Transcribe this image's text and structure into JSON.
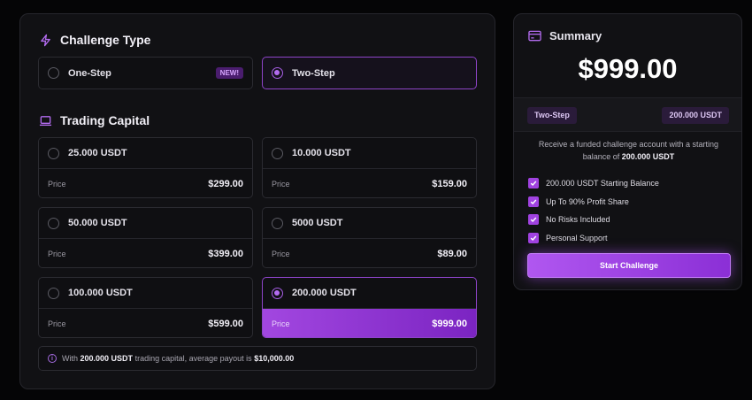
{
  "accent": "#a247e0",
  "challenge_type": {
    "title": "Challenge Type",
    "icon": "lightning-icon",
    "options": [
      {
        "label": "One-Step",
        "badge": "NEW!",
        "selected": false
      },
      {
        "label": "Two-Step",
        "selected": true
      }
    ]
  },
  "trading_capital": {
    "title": "Trading Capital",
    "icon": "laptop-icon",
    "price_label": "Price",
    "options": [
      {
        "label": "25.000 USDT",
        "price": "$299.00",
        "selected": false
      },
      {
        "label": "10.000 USDT",
        "price": "$159.00",
        "selected": false
      },
      {
        "label": "50.000 USDT",
        "price": "$399.00",
        "selected": false
      },
      {
        "label": "5000 USDT",
        "price": "$89.00",
        "selected": false
      },
      {
        "label": "100.000 USDT",
        "price": "$599.00",
        "selected": false
      },
      {
        "label": "200.000 USDT",
        "price": "$999.00",
        "selected": true
      }
    ]
  },
  "info": {
    "prefix": "With",
    "capital": "200.000 USDT",
    "middle": "trading capital, average payout is",
    "payout": "$10,000.00"
  },
  "summary": {
    "title": "Summary",
    "icon": "card-icon",
    "price": "$999.00",
    "type_chip": "Two-Step",
    "capital_chip": "200.000 USDT",
    "desc_text": "Receive a funded challenge account with a starting balance of",
    "desc_value": "200.000 USDT",
    "features": [
      "200.000 USDT Starting Balance",
      "Up To 90% Profit Share",
      "No Risks Included",
      "Personal Support"
    ],
    "cta": "Start Challenge"
  }
}
